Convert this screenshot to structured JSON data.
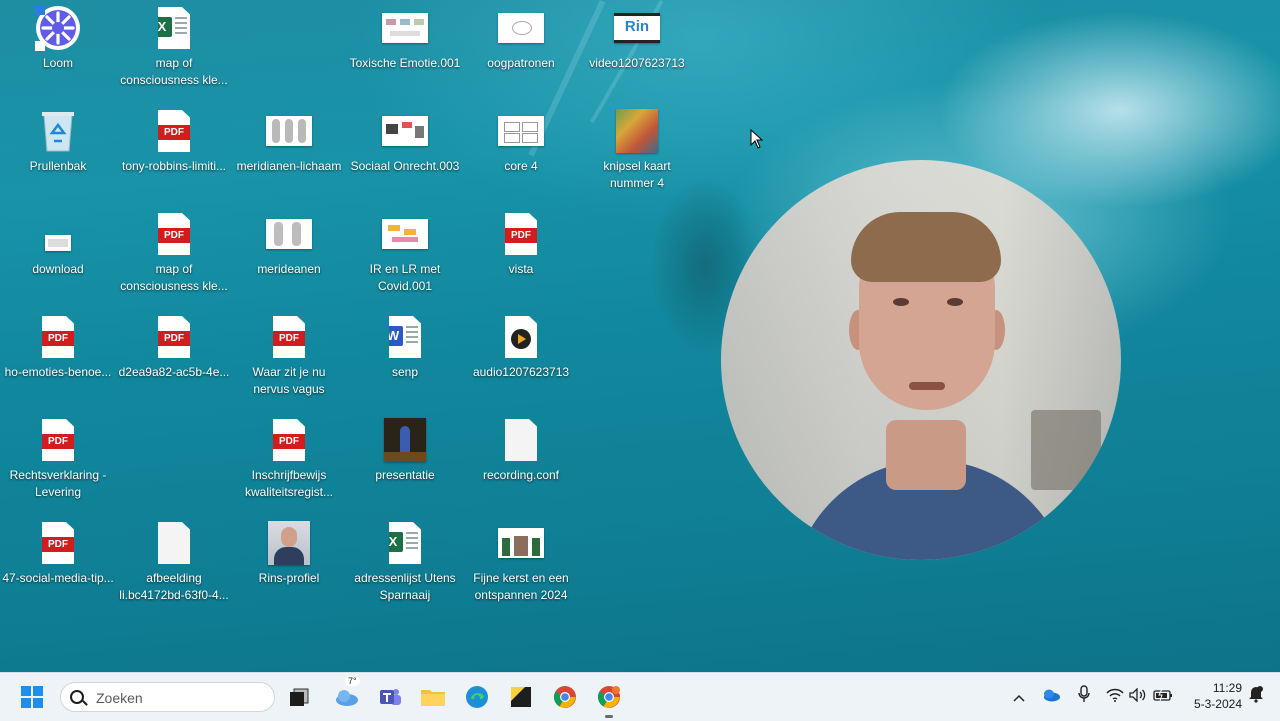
{
  "desktop": {
    "icons": [
      {
        "label": "Loom"
      },
      {
        "label": "map of consciousness kle..."
      },
      {
        "label": "Toxische Emotie.001"
      },
      {
        "label": "oogpatronen"
      },
      {
        "label": "video1207623713"
      },
      {
        "label": "Prullenbak"
      },
      {
        "label": "tony-robbins-limiti..."
      },
      {
        "label": "meridianen-lichaam"
      },
      {
        "label": "Sociaal Onrecht.003"
      },
      {
        "label": "core 4"
      },
      {
        "label": "knipsel kaart nummer 4"
      },
      {
        "label": "download"
      },
      {
        "label": "map of consciousness kle..."
      },
      {
        "label": "merideanen"
      },
      {
        "label": "IR en LR met Covid.001"
      },
      {
        "label": "vista"
      },
      {
        "label": "ho-emoties-benoe..."
      },
      {
        "label": "d2ea9a82-ac5b-4e..."
      },
      {
        "label": "Waar zit je nu nervus vagus"
      },
      {
        "label": "senp"
      },
      {
        "label": "audio1207623713"
      },
      {
        "label": "Rechtsverklaring - Levering"
      },
      {
        "label": "Inschrijfbewijs kwaliteitsregist..."
      },
      {
        "label": "presentatie"
      },
      {
        "label": "recording.conf"
      },
      {
        "label": "47-social-media-tip..."
      },
      {
        "label": "afbeelding li.bc4172bd-63f0-4..."
      },
      {
        "label": "Rins-profiel"
      },
      {
        "label": "adressenlijst Utens Sparnaaij"
      },
      {
        "label": "Fijne kerst en een ontspannen 2024"
      }
    ],
    "tags": {
      "pdf": "PDF",
      "excel": "X",
      "word": "W"
    },
    "video_thumb_text": "Rin"
  },
  "taskbar": {
    "search_placeholder": "Zoeken",
    "weather_temp": "7°",
    "time": "11:29",
    "date": "5-3-2024"
  },
  "colors": {
    "pdf_red": "#d21d1f",
    "excel_green": "#1d7044",
    "word_blue": "#2b5ac6",
    "taskbar": "#eef3f7"
  }
}
